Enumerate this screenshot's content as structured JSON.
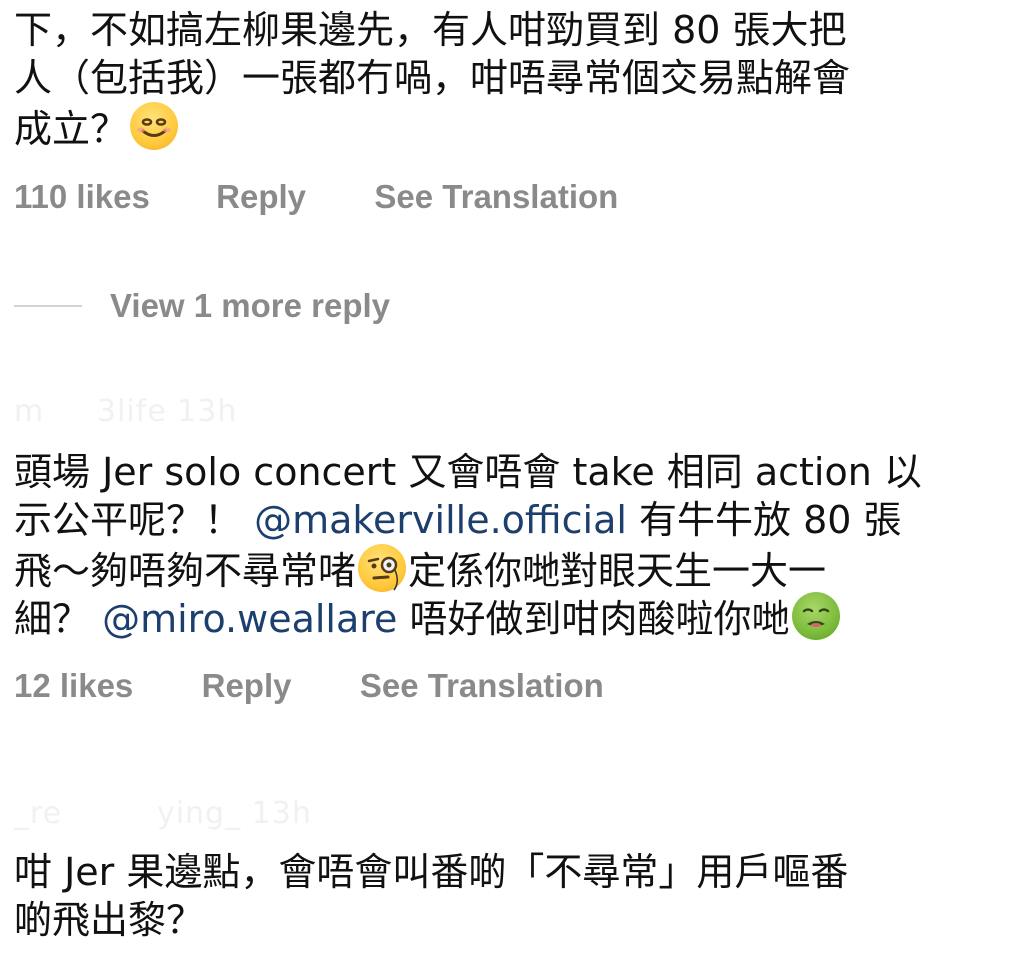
{
  "comments": [
    {
      "username_faded": "",
      "lines": [
        "下，不如搞左柳果邊先，有人咁勁買到 80 張大把",
        "人（包括我）一張都冇喎，咁唔尋常個交易點解會",
        "成立？"
      ],
      "emoji": "smiling-face",
      "likes": "110 likes",
      "reply": "Reply",
      "translate": "See Translation"
    },
    {
      "username_faded": "m      3life  13h",
      "line1": "頭場 Jer solo concert 又會唔會 take 相同 action 以",
      "line2_pre": "示公平呢？！ ",
      "mention1": "@makerville.official",
      "line2_post": " 有牛牛放 80 張",
      "line3_pre": "飛～夠唔夠不尋常啫",
      "emoji_monocle": "face-with-monocle",
      "line3_post": "定係你哋對眼天生一大一",
      "line4_pre": "細？ ",
      "mention2": "@miro.weallare",
      "line4_post": " 唔好做到咁肉酸啦你哋",
      "emoji_nauseated": "nauseated-face",
      "likes": "12 likes",
      "reply": "Reply",
      "translate": "See Translation"
    },
    {
      "username_faded": "_re          ying_  13h",
      "lines": [
        "咁 Jer 果邊點，會唔會叫番啲「不尋常」用戶嘔番",
        "啲飛出黎？"
      ]
    }
  ],
  "view_more": "View 1 more reply"
}
